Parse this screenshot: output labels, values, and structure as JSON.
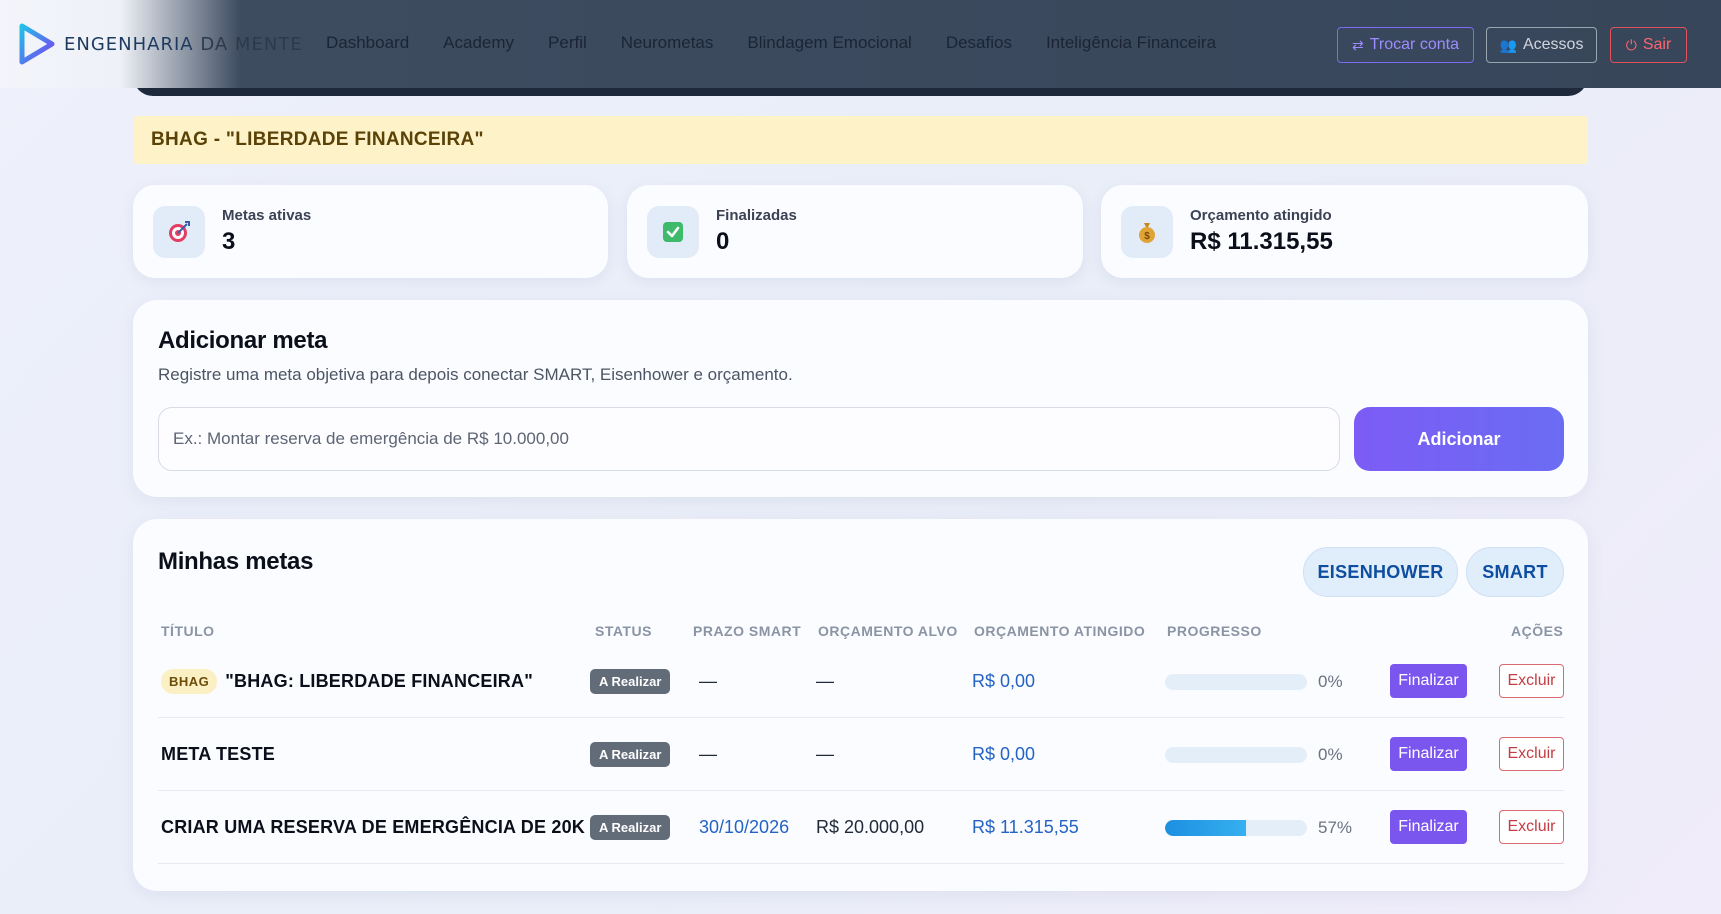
{
  "brand": {
    "name_part1": "ENGENHARIA",
    "name_part2": " DA MENTE"
  },
  "nav": {
    "links": [
      "Dashboard",
      "Academy",
      "Perfil",
      "Neurometas",
      "Blindagem Emocional",
      "Desafios",
      "Inteligência Financeira"
    ],
    "trocar_label": "Trocar conta",
    "acessos_label": "Acessos",
    "sair_label": "Sair"
  },
  "banner": {
    "text": "BHAG - \"LIBERDADE FINANCEIRA\""
  },
  "stats": [
    {
      "icon": "target-icon",
      "label": "Metas ativas",
      "value": "3"
    },
    {
      "icon": "checkbox-icon",
      "label": "Finalizadas",
      "value": "0"
    },
    {
      "icon": "money-bag-icon",
      "label": "Orçamento atingido",
      "value": "R$ 11.315,55"
    }
  ],
  "add_goal": {
    "title": "Adicionar meta",
    "subtitle": "Registre uma meta objetiva para depois conectar SMART, Eisenhower e orçamento.",
    "placeholder": "Ex.: Montar reserva de emergência de R$ 10.000,00",
    "button_label": "Adicionar"
  },
  "goals": {
    "title": "Minhas metas",
    "eisenhower_label": "EISENHOWER",
    "smart_label": "SMART",
    "columns": [
      "TÍTULO",
      "STATUS",
      "PRAZO SMART",
      "ORÇAMENTO ALVO",
      "ORÇAMENTO ATINGIDO",
      "PROGRESSO",
      "AÇÕES"
    ],
    "rows": [
      {
        "tag": "BHAG",
        "title": "\"BHAG: LIBERDADE FINANCEIRA\"",
        "status": "A Realizar",
        "prazo": "—",
        "alvo": "—",
        "atingido": "R$ 0,00",
        "progress": 0,
        "progress_label": "0%",
        "finalizar": "Finalizar",
        "excluir": "Excluir"
      },
      {
        "tag": "",
        "title": "META TESTE",
        "status": "A Realizar",
        "prazo": "—",
        "alvo": "—",
        "atingido": "R$ 0,00",
        "progress": 0,
        "progress_label": "0%",
        "finalizar": "Finalizar",
        "excluir": "Excluir"
      },
      {
        "tag": "",
        "title": "CRIAR UMA RESERVA DE EMERGÊNCIA DE 20K",
        "status": "A Realizar",
        "prazo": "30/10/2026",
        "alvo": "R$ 20.000,00",
        "atingido": "R$ 11.315,55",
        "progress": 57,
        "progress_label": "57%",
        "finalizar": "Finalizar",
        "excluir": "Excluir"
      }
    ]
  },
  "colors": {
    "accent": "#7b56ee",
    "link": "#2463c4",
    "danger": "#c43c44",
    "banner_bg": "#fdf2c8"
  }
}
